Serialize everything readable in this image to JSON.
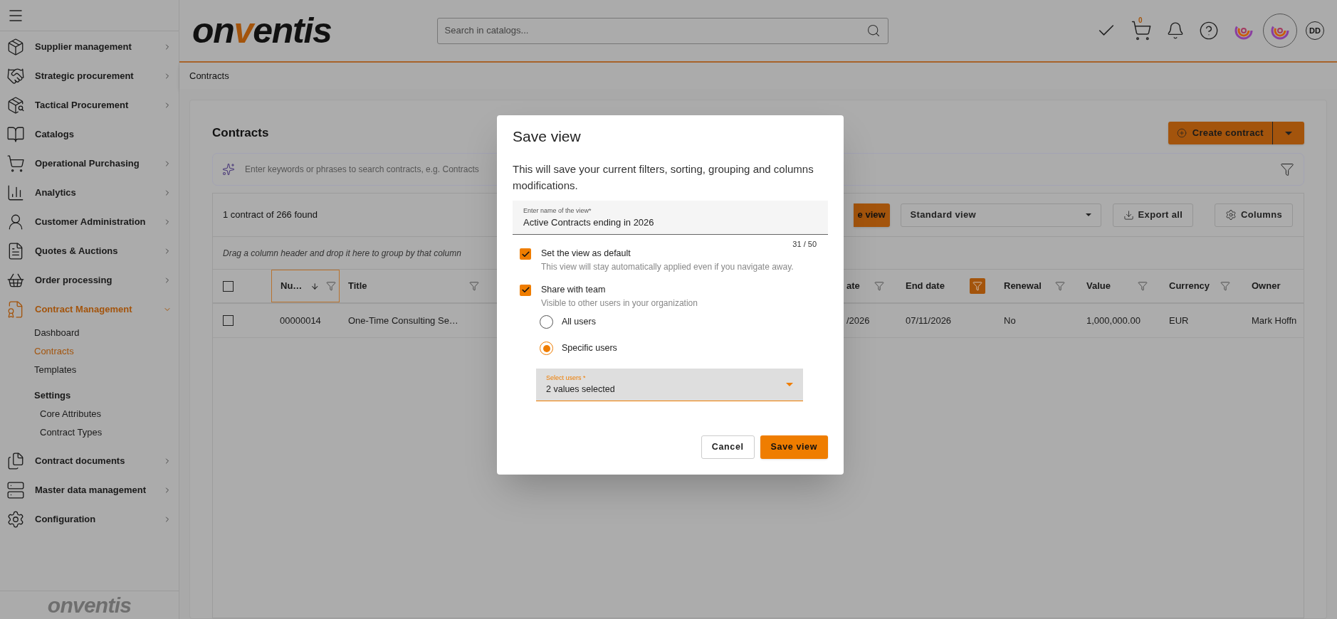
{
  "sidebar": {
    "items": [
      {
        "label": "Supplier management",
        "expandable": true,
        "expanded": false,
        "selected": false
      },
      {
        "label": "Strategic procurement",
        "expandable": true,
        "expanded": false,
        "selected": false
      },
      {
        "label": "Tactical Procurement",
        "expandable": true,
        "expanded": false,
        "selected": false
      },
      {
        "label": "Catalogs",
        "expandable": false,
        "selected": false
      },
      {
        "label": "Operational Purchasing",
        "expandable": true,
        "expanded": false,
        "selected": false
      },
      {
        "label": "Analytics",
        "expandable": true,
        "expanded": false,
        "selected": false
      },
      {
        "label": "Customer Administration",
        "expandable": true,
        "expanded": false,
        "selected": false
      },
      {
        "label": "Quotes & Auctions",
        "expandable": true,
        "expanded": false,
        "selected": false
      },
      {
        "label": "Order processing",
        "expandable": true,
        "expanded": false,
        "selected": false
      },
      {
        "label": "Contract Management",
        "expandable": true,
        "expanded": true,
        "selected": true,
        "children": [
          {
            "label": "Dashboard",
            "kind": "link",
            "selected": false
          },
          {
            "label": "Contracts",
            "kind": "link",
            "selected": true
          },
          {
            "label": "Templates",
            "kind": "link",
            "selected": false
          },
          {
            "label": "Settings",
            "kind": "heading",
            "children": [
              {
                "label": "Core Attributes",
                "kind": "link",
                "selected": false
              },
              {
                "label": "Contract Types",
                "kind": "link",
                "selected": false
              }
            ]
          }
        ]
      },
      {
        "label": "Contract documents",
        "expandable": true,
        "expanded": false,
        "selected": false
      },
      {
        "label": "Master data management",
        "expandable": true,
        "expanded": false,
        "selected": false
      },
      {
        "label": "Configuration",
        "expandable": true,
        "expanded": false,
        "selected": false
      }
    ],
    "footer_logo": {
      "parts": [
        "on",
        "v",
        "entis"
      ]
    }
  },
  "header": {
    "logo": {
      "parts": [
        "on",
        "v",
        "entis"
      ]
    },
    "search": {
      "placeholder": "Search in catalogs..."
    },
    "cart_count": "0",
    "avatar": "DD"
  },
  "breadcrumb": "Contracts",
  "page": {
    "title": "Contracts",
    "create_button": "Create contract",
    "search": {
      "placeholder": "Enter keywords or phrases to search contracts, e.g. Contracts"
    },
    "result_count": "1 contract of 266 found",
    "save_view_button": "e view",
    "view_select": "Standard view",
    "export_button": "Export all",
    "columns_button": "Columns",
    "group_hint": "Drag a column header and drop it here to group by that column",
    "table": {
      "select_all_checked": false,
      "columns": [
        {
          "kind": "text",
          "label": "Nu…",
          "sorted": true,
          "filter": true,
          "filter_active": false,
          "selected": true
        },
        {
          "kind": "text",
          "label": "Title",
          "sorted": false,
          "filter": true,
          "filter_active": false,
          "selected": false
        },
        {
          "kind": "hidden"
        },
        {
          "kind": "text",
          "label": "ate",
          "sorted": false,
          "filter": true,
          "filter_active": false,
          "selected": false
        },
        {
          "kind": "text",
          "label": "End date",
          "sorted": false,
          "filter": true,
          "filter_active": true,
          "selected": false
        },
        {
          "kind": "text",
          "label": "Renewal",
          "sorted": false,
          "filter": true,
          "filter_active": false,
          "selected": false
        },
        {
          "kind": "text",
          "label": "Value",
          "sorted": false,
          "filter": true,
          "filter_active": false,
          "selected": false
        },
        {
          "kind": "text",
          "label": "Currency",
          "sorted": false,
          "filter": true,
          "filter_active": false,
          "selected": false
        },
        {
          "kind": "text",
          "label": "Owner",
          "sorted": false,
          "selected": false
        }
      ],
      "rows": [
        {
          "checked": false,
          "cells": [
            "00000014",
            "One-Time Consulting Se…",
            "",
            "/2026",
            "07/11/2026",
            "No",
            "1,000,000.00",
            "EUR",
            "Mark Hoffn"
          ]
        }
      ]
    }
  },
  "dialog": {
    "title": "Save view",
    "description": "This will save your current filters, sorting, grouping and columns modifications.",
    "name_field": {
      "label": "Enter name of the view*",
      "value": "Active Contracts ending in 2026",
      "counter": "31 / 50"
    },
    "options": [
      {
        "label": "Set the view as default",
        "hint": "This view will stay automatically applied even if you navigate away.",
        "checked": true
      },
      {
        "label": "Share with team",
        "hint": "Visible to other users in your organization",
        "checked": true
      }
    ],
    "radios": [
      {
        "label": "All users",
        "selected": false
      },
      {
        "label": "Specific users",
        "selected": true
      }
    ],
    "select": {
      "label": "Select users *",
      "value": "2 values selected"
    },
    "buttons": [
      {
        "label": "Cancel",
        "kind": "secondary"
      },
      {
        "label": "Save view",
        "kind": "primary"
      }
    ]
  }
}
